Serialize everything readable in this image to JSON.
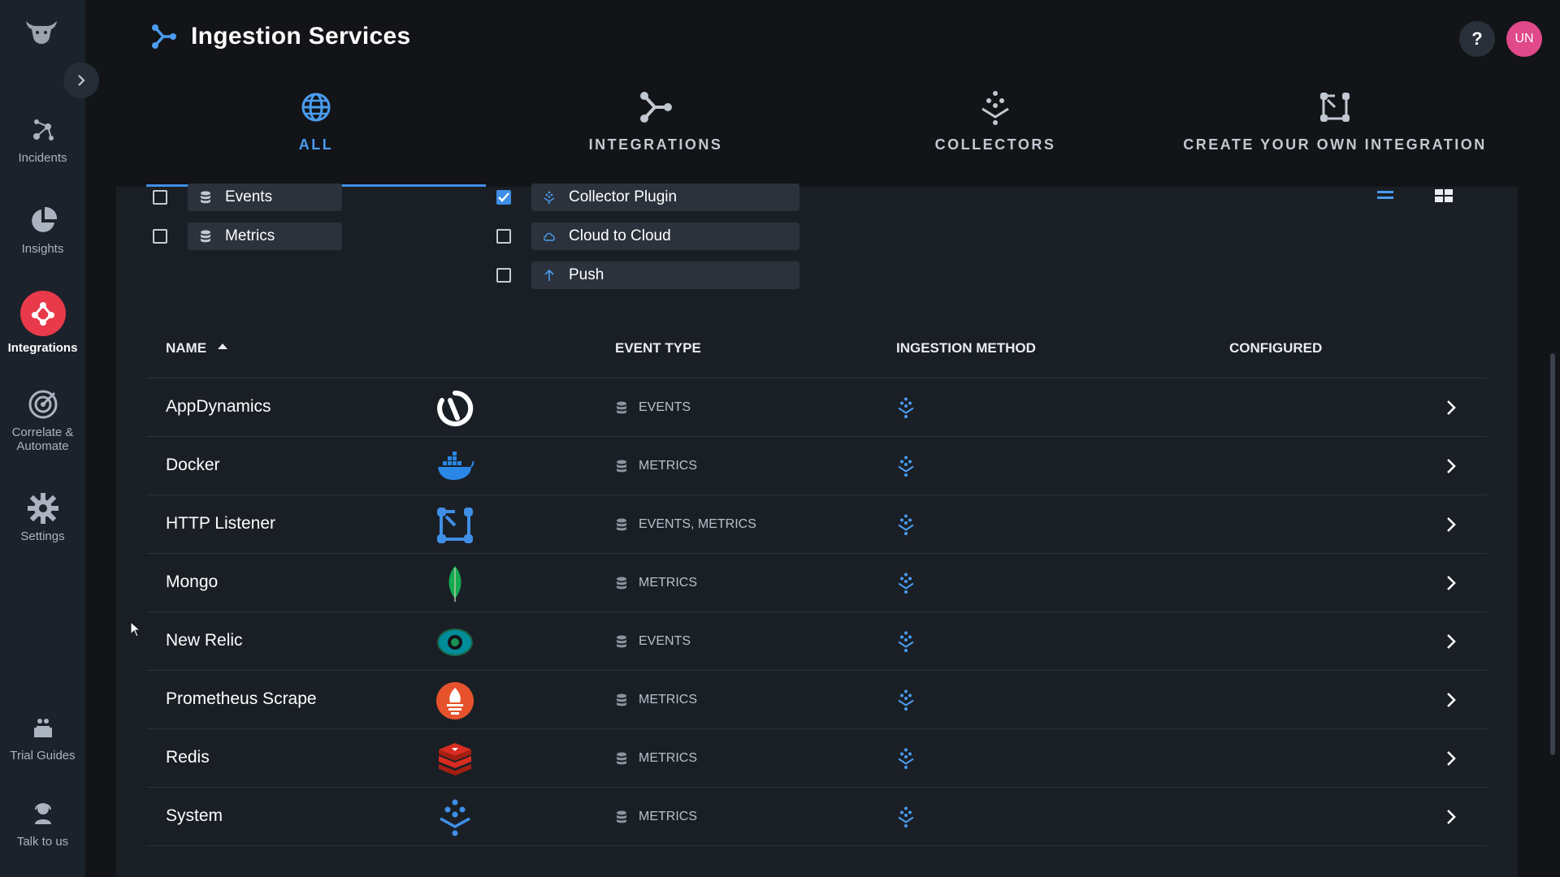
{
  "sidebar": {
    "items": [
      {
        "label": "Incidents",
        "icon": "incidents-icon"
      },
      {
        "label": "Insights",
        "icon": "pie-chart-icon"
      },
      {
        "label": "Integrations",
        "icon": "integrations-icon",
        "active": true
      },
      {
        "label": "Correlate & Automate",
        "icon": "target-icon"
      },
      {
        "label": "Settings",
        "icon": "gear-icon"
      },
      {
        "label": "Trial Guides",
        "icon": "guide-icon"
      },
      {
        "label": "Talk to us",
        "icon": "support-agent-icon"
      }
    ]
  },
  "header": {
    "title": "Ingestion Services",
    "help_label": "?",
    "avatar_initials": "UN"
  },
  "tabs": [
    {
      "label": "ALL",
      "icon": "globe-icon",
      "active": true
    },
    {
      "label": "INTEGRATIONS",
      "icon": "integrations-icon",
      "active": false
    },
    {
      "label": "COLLECTORS",
      "icon": "collector-icon",
      "active": false
    },
    {
      "label": "CREATE YOUR OWN INTEGRATION",
      "icon": "custom-integration-icon",
      "active": false
    }
  ],
  "filters": {
    "event_types": [
      {
        "label": "Events",
        "checked": false
      },
      {
        "label": "Metrics",
        "checked": false
      }
    ],
    "ingestion_methods": [
      {
        "label": "Collector Plugin",
        "checked": true
      },
      {
        "label": "Cloud to Cloud",
        "checked": false
      },
      {
        "label": "Push",
        "checked": false
      }
    ]
  },
  "table": {
    "columns": [
      "NAME",
      "EVENT TYPE",
      "INGESTION METHOD",
      "CONFIGURED"
    ],
    "sort_column": "NAME",
    "sort_direction": "ascending",
    "rows": [
      {
        "name": "AppDynamics",
        "logo": "appdynamics-logo",
        "event_type": "EVENTS",
        "method": "collector-plugin"
      },
      {
        "name": "Docker",
        "logo": "docker-logo",
        "event_type": "METRICS",
        "method": "collector-plugin"
      },
      {
        "name": "HTTP Listener",
        "logo": "http-listener-logo",
        "event_type": "EVENTS, METRICS",
        "method": "collector-plugin"
      },
      {
        "name": "Mongo",
        "logo": "mongo-logo",
        "event_type": "METRICS",
        "method": "collector-plugin"
      },
      {
        "name": "New Relic",
        "logo": "new-relic-logo",
        "event_type": "EVENTS",
        "method": "collector-plugin"
      },
      {
        "name": "Prometheus Scrape",
        "logo": "prometheus-logo",
        "event_type": "METRICS",
        "method": "collector-plugin"
      },
      {
        "name": "Redis",
        "logo": "redis-logo",
        "event_type": "METRICS",
        "method": "collector-plugin"
      },
      {
        "name": "System",
        "logo": "system-collector-logo",
        "event_type": "METRICS",
        "method": "collector-plugin"
      }
    ]
  },
  "colors": {
    "accent": "#3f8fe6",
    "integrations_active": "#e83a4a",
    "avatar": "#e0498a"
  }
}
